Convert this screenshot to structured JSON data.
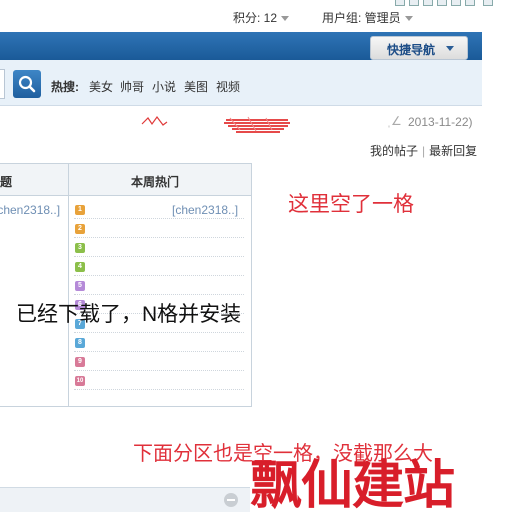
{
  "header": {
    "score_label": "积分: 12",
    "usergroup_label": "用户组: 管理员",
    "quick_nav": "快捷导航"
  },
  "search": {
    "hot_label": "热搜:",
    "hot_items": [
      "美女",
      "帅哥",
      "小说",
      "美图",
      "视频"
    ]
  },
  "post": {
    "date": "2013-11-22)"
  },
  "links": {
    "my_threads": "我的帖子",
    "separator": "|",
    "latest_reply": "最新回复"
  },
  "table": {
    "left_header_fragment": "题",
    "right_header": "本周热门",
    "left_user": "[chen2318..]",
    "right_user": "[chen2318..]",
    "ranks": [
      "1",
      "2",
      "3",
      "4",
      "5",
      "6",
      "7",
      "8",
      "9",
      "10"
    ]
  },
  "annotations": {
    "top_right": "这里空了一格",
    "middle": "已经下载了，N格并安装",
    "bottom": "下面分区也是空一格，没截那么大"
  },
  "watermark": "飘仙建站",
  "colors": {
    "nav_blue": "#1a5a98",
    "annotation_red": "#e0303a",
    "watermark_red": "#d81e2a",
    "link_blue": "#6f8fb4"
  }
}
